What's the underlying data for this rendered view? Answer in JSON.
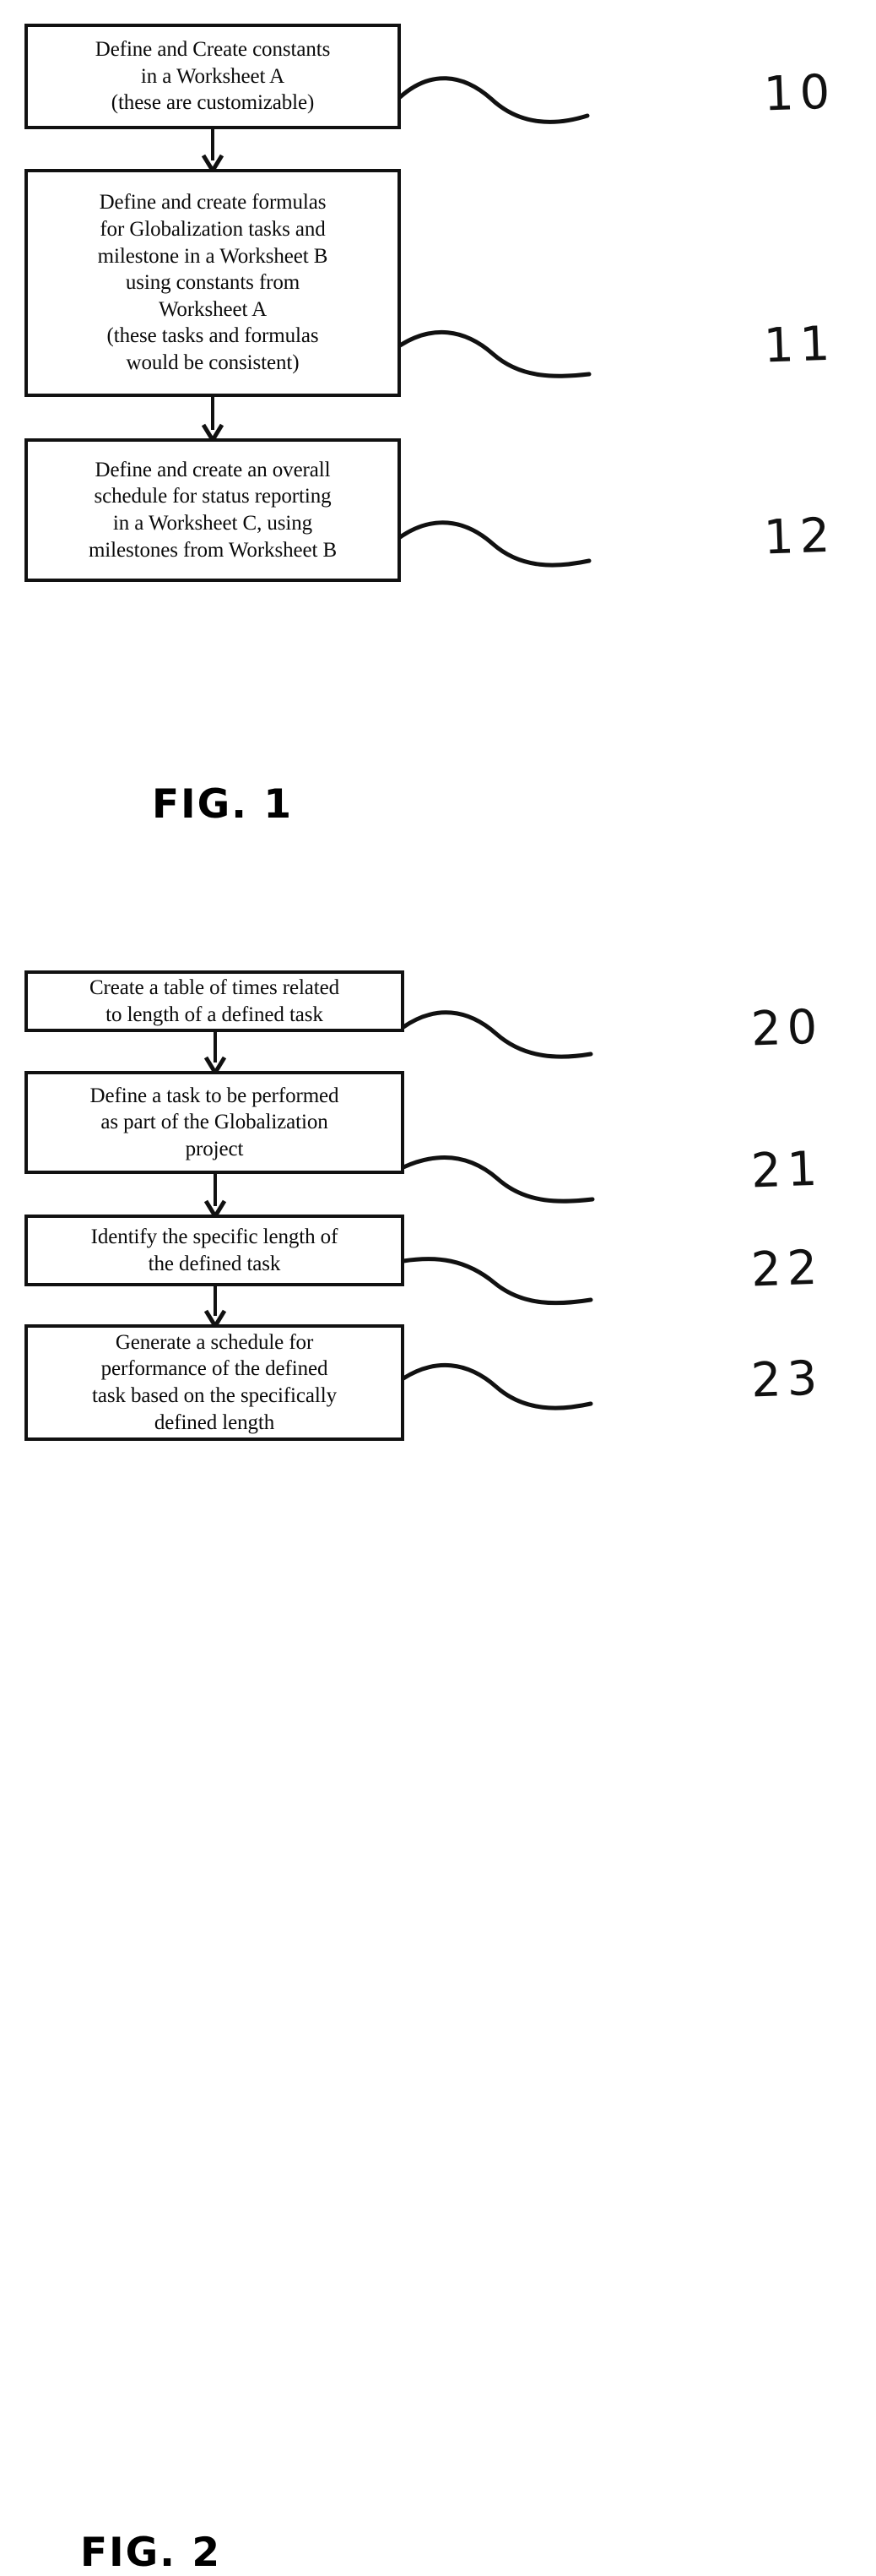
{
  "document": {
    "type": "patent-flowchart",
    "background_color": "#ffffff",
    "ink_color": "#111111"
  },
  "figures": [
    {
      "caption": "FIG. 1",
      "steps": [
        {
          "ref": "10",
          "text": "Define and Create constants\nin a Worksheet A\n(these are customizable)"
        },
        {
          "ref": "11",
          "text": "Define and create formulas\nfor Globalization tasks and\nmilestone in a Worksheet B\nusing constants from\nWorksheet A\n(these tasks and formulas\nwould be consistent)"
        },
        {
          "ref": "12",
          "text": "Define and create an overall\nschedule for status reporting\nin a Worksheet C, using\nmilestones from Worksheet B"
        }
      ]
    },
    {
      "caption": "FIG. 2",
      "steps": [
        {
          "ref": "20",
          "text": "Create a table of times related\nto length of a defined task"
        },
        {
          "ref": "21",
          "text": "Define a task to be performed\nas part of the Globalization\nproject"
        },
        {
          "ref": "22",
          "text": "Identify the specific length of\nthe defined task"
        },
        {
          "ref": "23",
          "text": "Generate a schedule for\nperformance of the defined\ntask based on the specifically\ndefined length"
        }
      ]
    }
  ],
  "icons": {
    "arrow_down": "down-arrow-icon",
    "leader_line": "leader-line-icon"
  }
}
